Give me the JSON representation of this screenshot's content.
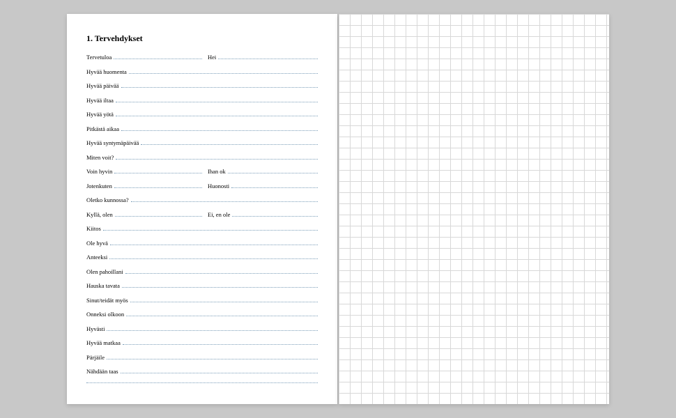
{
  "heading": "1. Tervehdykset",
  "rows": [
    {
      "type": "double",
      "left": "Tervetuloa",
      "right": "Hei"
    },
    {
      "type": "single",
      "text": "Hyvää huomenta"
    },
    {
      "type": "single",
      "text": "Hyvää päivää"
    },
    {
      "type": "single",
      "text": "Hyvää iltaa"
    },
    {
      "type": "single",
      "text": "Hyvää yötä"
    },
    {
      "type": "single",
      "text": "Pitkästä aikaa"
    },
    {
      "type": "single",
      "text": "Hyvää syntymäpäivää"
    },
    {
      "type": "single",
      "text": "Miten voit?"
    },
    {
      "type": "double",
      "left": "Voin hyvin",
      "right": "Ihan ok"
    },
    {
      "type": "double",
      "left": "Jotenkuten",
      "right": "Huonosti"
    },
    {
      "type": "single",
      "text": "Oletko kunnossa?"
    },
    {
      "type": "double",
      "left": "Kyllä, olen",
      "right": "Ei, en ole"
    },
    {
      "type": "single",
      "text": "Kiitos"
    },
    {
      "type": "single",
      "text": "Ole hyvä"
    },
    {
      "type": "single",
      "text": "Anteeksi"
    },
    {
      "type": "single",
      "text": "Olen pahoillani"
    },
    {
      "type": "single",
      "text": "Hauska tavata"
    },
    {
      "type": "single",
      "text": "Sinut/teidät myös"
    },
    {
      "type": "single",
      "text": "Onneksi olkoon"
    },
    {
      "type": "single",
      "text": "Hyvästi"
    },
    {
      "type": "single",
      "text": "Hyvää matkaa"
    },
    {
      "type": "single",
      "text": "Pärjäile"
    },
    {
      "type": "single",
      "text": "Nähdään taas"
    },
    {
      "type": "blank"
    }
  ]
}
